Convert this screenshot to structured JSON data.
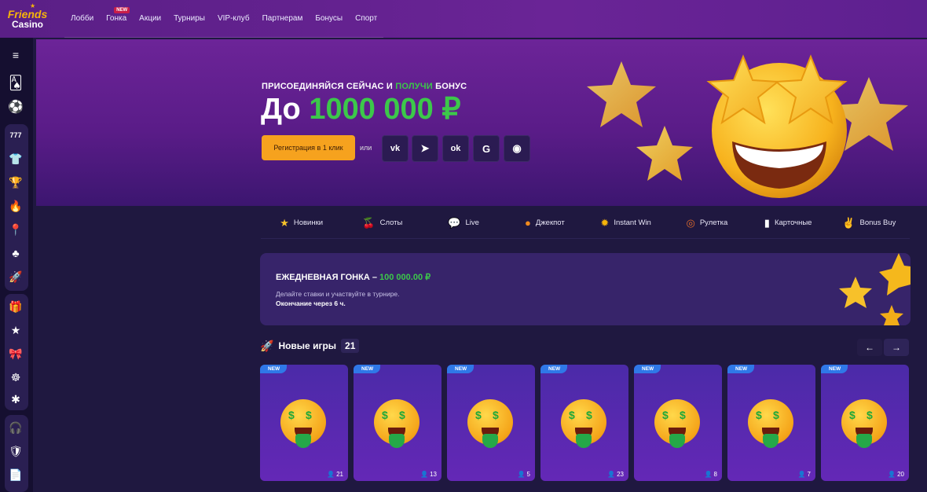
{
  "brand": {
    "line1": "Friends",
    "line2": "Casino"
  },
  "nav": [
    {
      "label": "Лобби"
    },
    {
      "label": "Гонка",
      "badge": "NEW"
    },
    {
      "label": "Акции"
    },
    {
      "label": "Турниры"
    },
    {
      "label": "VIP-клуб"
    },
    {
      "label": "Партнерам"
    },
    {
      "label": "Бонусы"
    },
    {
      "label": "Спорт"
    }
  ],
  "sidebar_icons": [
    "menu-icon",
    "cards-icon",
    "soccer-ball-icon",
    "slot-777-icon",
    "jersey-icon",
    "trophy-icon",
    "fire-icon",
    "pin-icon",
    "poker-chip-icon",
    "rocket-icon",
    "gift-box-icon",
    "star-icon",
    "gift-icon",
    "wheel-icon",
    "sparkle-icon",
    "headset-icon",
    "shield-icon",
    "document-icon"
  ],
  "banner": {
    "sub_prefix": "ПРИСОЕДИНЯЙСЯ СЕЙЧАС И ",
    "sub_highlight": "ПОЛУЧИ",
    "sub_suffix": " БОНУС",
    "main_prefix": "До ",
    "main_amount": "1000 000 ₽",
    "register_button": "Регистрация в 1 клик",
    "or_text": "или",
    "social": [
      {
        "name": "vk",
        "glyph": "vk"
      },
      {
        "name": "telegram",
        "glyph": "➤"
      },
      {
        "name": "odnoklassniki",
        "glyph": "ok"
      },
      {
        "name": "google",
        "glyph": "G"
      },
      {
        "name": "steam",
        "glyph": "◉"
      }
    ]
  },
  "categories": [
    {
      "label": "Новинки",
      "icon": "★",
      "color": "#f6c22a"
    },
    {
      "label": "Слоты",
      "icon": "🍒",
      "color": "#e0303a"
    },
    {
      "label": "Live",
      "icon": "💬",
      "color": "#f0d58a"
    },
    {
      "label": "Джекпот",
      "icon": "●",
      "color": "#f08a1e"
    },
    {
      "label": "Instant Win",
      "icon": "✹",
      "color": "#f6b40a"
    },
    {
      "label": "Рулетка",
      "icon": "◎",
      "color": "#e06a2a"
    },
    {
      "label": "Карточные",
      "icon": "▮",
      "color": "#ffffff"
    },
    {
      "label": "Bonus Buy",
      "icon": "✌",
      "color": "#f0c7a0"
    }
  ],
  "race": {
    "title": "ЕЖЕДНЕВНАЯ ГОНКА – ",
    "prize": "100 000.00 ₽",
    "desc": "Делайте ставки и участвуйте в турнире.",
    "ends": "Окончание через 6 ч."
  },
  "games": {
    "title": "Новые игры",
    "count": "21",
    "prev": "←",
    "next": "→",
    "badge": "NEW",
    "players": [
      "21",
      "13",
      "5",
      "23",
      "8",
      "7",
      "20"
    ]
  }
}
